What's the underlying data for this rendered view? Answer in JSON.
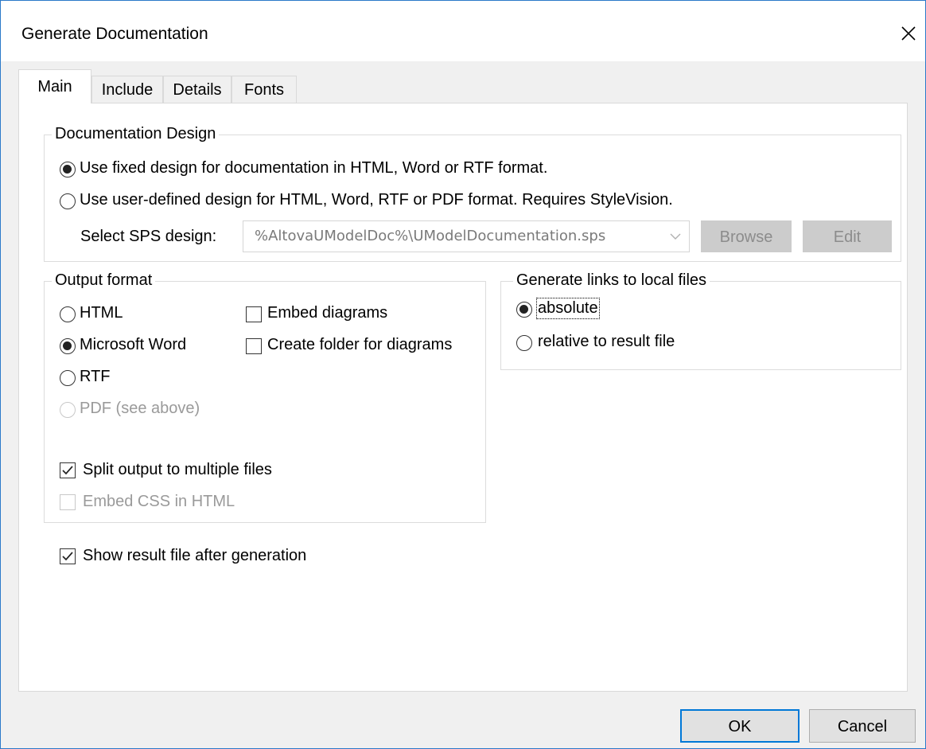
{
  "window": {
    "title": "Generate Documentation"
  },
  "tabs": [
    {
      "label": "Main",
      "active": true
    },
    {
      "label": "Include"
    },
    {
      "label": "Details"
    },
    {
      "label": "Fonts"
    }
  ],
  "documentation_design": {
    "legend": "Documentation Design",
    "option_fixed": "Use fixed design for documentation in HTML, Word or RTF format.",
    "option_user_defined": "Use user-defined design for HTML, Word, RTF or PDF format. Requires StyleVision.",
    "selected": "fixed",
    "sps_label": "Select SPS design:",
    "sps_value": "%AltovaUModelDoc%\\UModelDocumentation.sps",
    "browse_label": "Browse",
    "edit_label": "Edit"
  },
  "output_format": {
    "legend": "Output format",
    "html": "HTML",
    "word": "Microsoft Word",
    "rtf": "RTF",
    "pdf": "PDF (see above)",
    "selected": "Microsoft Word",
    "embed_diagrams": "Embed diagrams",
    "embed_diagrams_checked": false,
    "create_folder": "Create folder for diagrams",
    "create_folder_checked": false,
    "split_output": "Split output to multiple files",
    "split_output_checked": true,
    "embed_css": "Embed CSS in HTML",
    "embed_css_checked": false
  },
  "links": {
    "legend": "Generate links to local files",
    "absolute": "absolute",
    "relative": "relative to result file",
    "selected": "absolute"
  },
  "show_result": {
    "label": "Show result file after generation",
    "checked": true
  },
  "buttons": {
    "ok": "OK",
    "cancel": "Cancel"
  },
  "colors": {
    "focus_border": "#0078d7",
    "window_border": "#2b79c9",
    "dialog_bg": "#f0f0f0"
  }
}
